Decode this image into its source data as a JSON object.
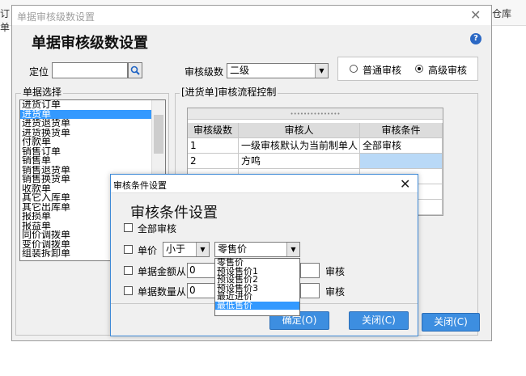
{
  "background": {
    "left_text": "订单",
    "right_text": "仓库"
  },
  "main_dialog": {
    "window_title": "单据审核级数设置",
    "heading": "单据审核级数设置",
    "help_glyph": "?",
    "locate_label": "定位",
    "locate_value": "",
    "level_label": "审核级数",
    "level_value": "二级",
    "mode_options": [
      "普通审核",
      "高级审核"
    ],
    "mode_selected": "高级审核",
    "doc_group_title": "单据选择",
    "doc_list": [
      "进货订单",
      "进货单",
      "进货退货单",
      "进货换货单",
      "付款单",
      "销售订单",
      "销售单",
      "销售退货单",
      "销售换货单",
      "收款单",
      "其它入库单",
      "其它出库单",
      "报损单",
      "报益单",
      "同价调拨单",
      "变价调拨单",
      "组装拆卸单"
    ],
    "doc_selected_index": 1,
    "flow_group_title": "[进货单]审核流程控制",
    "grid_top_marks": "•••••••••••••••",
    "grid_headers": [
      "审核级数",
      "审核人",
      "审核条件"
    ],
    "grid_rows": [
      [
        "1",
        "一级审核默认为当前制单人",
        "全部审核"
      ],
      [
        "2",
        "方鸣",
        ""
      ]
    ],
    "close_button": "关闭(C)"
  },
  "sub_dialog": {
    "window_title": "审核条件设置",
    "heading": "审核条件设置",
    "cond_all": "全部审核",
    "cond_price": "单价",
    "price_operator": "小于",
    "price_field": "零售价",
    "cond_amount": "单据金额从",
    "amount_from": "0",
    "amount_suffix": "审核",
    "cond_qty": "单据数量从",
    "qty_from": "0",
    "qty_suffix": "审核",
    "dropdown_options": [
      "零售价",
      "预设售价1",
      "预设售价2",
      "预设售价3",
      "最近进价",
      "最低售价"
    ],
    "dropdown_selected_index": 5,
    "ok_button": "确定(O)",
    "close_button": "关闭(C)"
  }
}
